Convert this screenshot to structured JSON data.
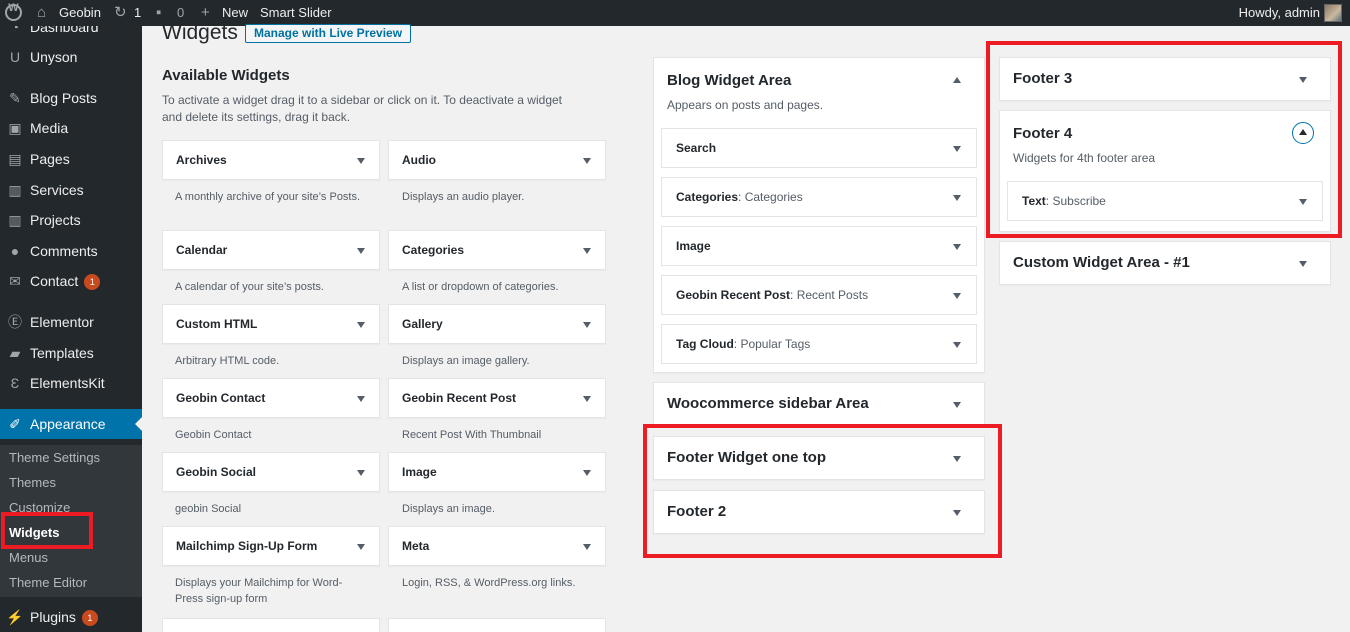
{
  "adminbar": {
    "site_name": "Geobin",
    "updates_count": "1",
    "comments_count": "0",
    "new_label": "New",
    "smart_slider": "Smart Slider",
    "howdy": "Howdy, admin"
  },
  "sidebar": {
    "items": [
      {
        "label": "Dashboard",
        "icon": "dashboard-icon",
        "glyph": "◔"
      },
      {
        "label": "Unyson",
        "icon": "unyson-icon",
        "glyph": "U"
      },
      {
        "label": "Blog Posts",
        "icon": "pin-icon",
        "glyph": "✎"
      },
      {
        "label": "Media",
        "icon": "media-icon",
        "glyph": "▣"
      },
      {
        "label": "Pages",
        "icon": "pages-icon",
        "glyph": "▤"
      },
      {
        "label": "Services",
        "icon": "services-icon",
        "glyph": "▥"
      },
      {
        "label": "Projects",
        "icon": "projects-icon",
        "glyph": "▥"
      },
      {
        "label": "Comments",
        "icon": "comments-icon",
        "glyph": "●"
      },
      {
        "label": "Contact",
        "icon": "mail-icon",
        "glyph": "✉",
        "badge": "1"
      },
      {
        "label": "Elementor",
        "icon": "elementor-icon",
        "glyph": "Ⓔ"
      },
      {
        "label": "Templates",
        "icon": "folder-icon",
        "glyph": "▰"
      },
      {
        "label": "ElementsKit",
        "icon": "elementskit-icon",
        "glyph": "Ɛ"
      },
      {
        "label": "Appearance",
        "icon": "brush-icon",
        "glyph": "✐"
      },
      {
        "label": "Plugins",
        "icon": "plugin-icon",
        "glyph": "⚡",
        "badge": "1"
      }
    ],
    "submenu": [
      "Theme Settings",
      "Themes",
      "Customize",
      "Widgets",
      "Menus",
      "Theme Editor"
    ]
  },
  "page": {
    "title": "Widgets",
    "live_preview": "Manage with Live Preview",
    "available_title": "Available Widgets",
    "available_desc": "To activate a widget drag it to a sidebar or click on it. To deactivate a widget and delete its settings, drag it back."
  },
  "available_widgets": [
    {
      "title": "Archives",
      "desc": "A monthly archive of your site’s Posts."
    },
    {
      "title": "Audio",
      "desc": "Displays an audio player."
    },
    {
      "title": "Calendar",
      "desc": "A calendar of your site’s posts."
    },
    {
      "title": "Categories",
      "desc": "A list or dropdown of categories."
    },
    {
      "title": "Custom HTML",
      "desc": "Arbitrary HTML code."
    },
    {
      "title": "Gallery",
      "desc": "Displays an image gallery."
    },
    {
      "title": "Geobin Contact",
      "desc": "Geobin Contact"
    },
    {
      "title": "Geobin Recent Post",
      "desc": "Recent Post With Thumbnail"
    },
    {
      "title": "Geobin Social",
      "desc": "geobin Social"
    },
    {
      "title": "Image",
      "desc": "Displays an image."
    },
    {
      "title": "Mailchimp Sign-Up Form",
      "desc": "Displays your Mailchimp for Word-Press sign-up form"
    },
    {
      "title": "Meta",
      "desc": "Login, RSS, & WordPress.org links."
    }
  ],
  "blog_area": {
    "title": "Blog Widget Area",
    "desc": "Appears on posts and pages.",
    "widgets": [
      {
        "title": "Search",
        "sub": ""
      },
      {
        "title": "Categories",
        "sub": ": Categories"
      },
      {
        "title": "Image",
        "sub": ""
      },
      {
        "title": "Geobin Recent Post",
        "sub": ": Recent Posts"
      },
      {
        "title": "Tag Cloud",
        "sub": ": Popular Tags"
      }
    ]
  },
  "middle_areas": [
    "Woocommerce sidebar Area",
    "Footer Widget one top",
    "Footer 2"
  ],
  "right_areas": {
    "footer3": "Footer 3",
    "footer4": {
      "title": "Footer 4",
      "desc": "Widgets for 4th footer area",
      "widget_title": "Text",
      "widget_sub": ": Subscribe"
    },
    "custom": "Custom Widget Area - #1"
  },
  "colors": {
    "highlight": "#ed1c24",
    "accent": "#0073aa",
    "sidebar_bg": "#23282d"
  }
}
